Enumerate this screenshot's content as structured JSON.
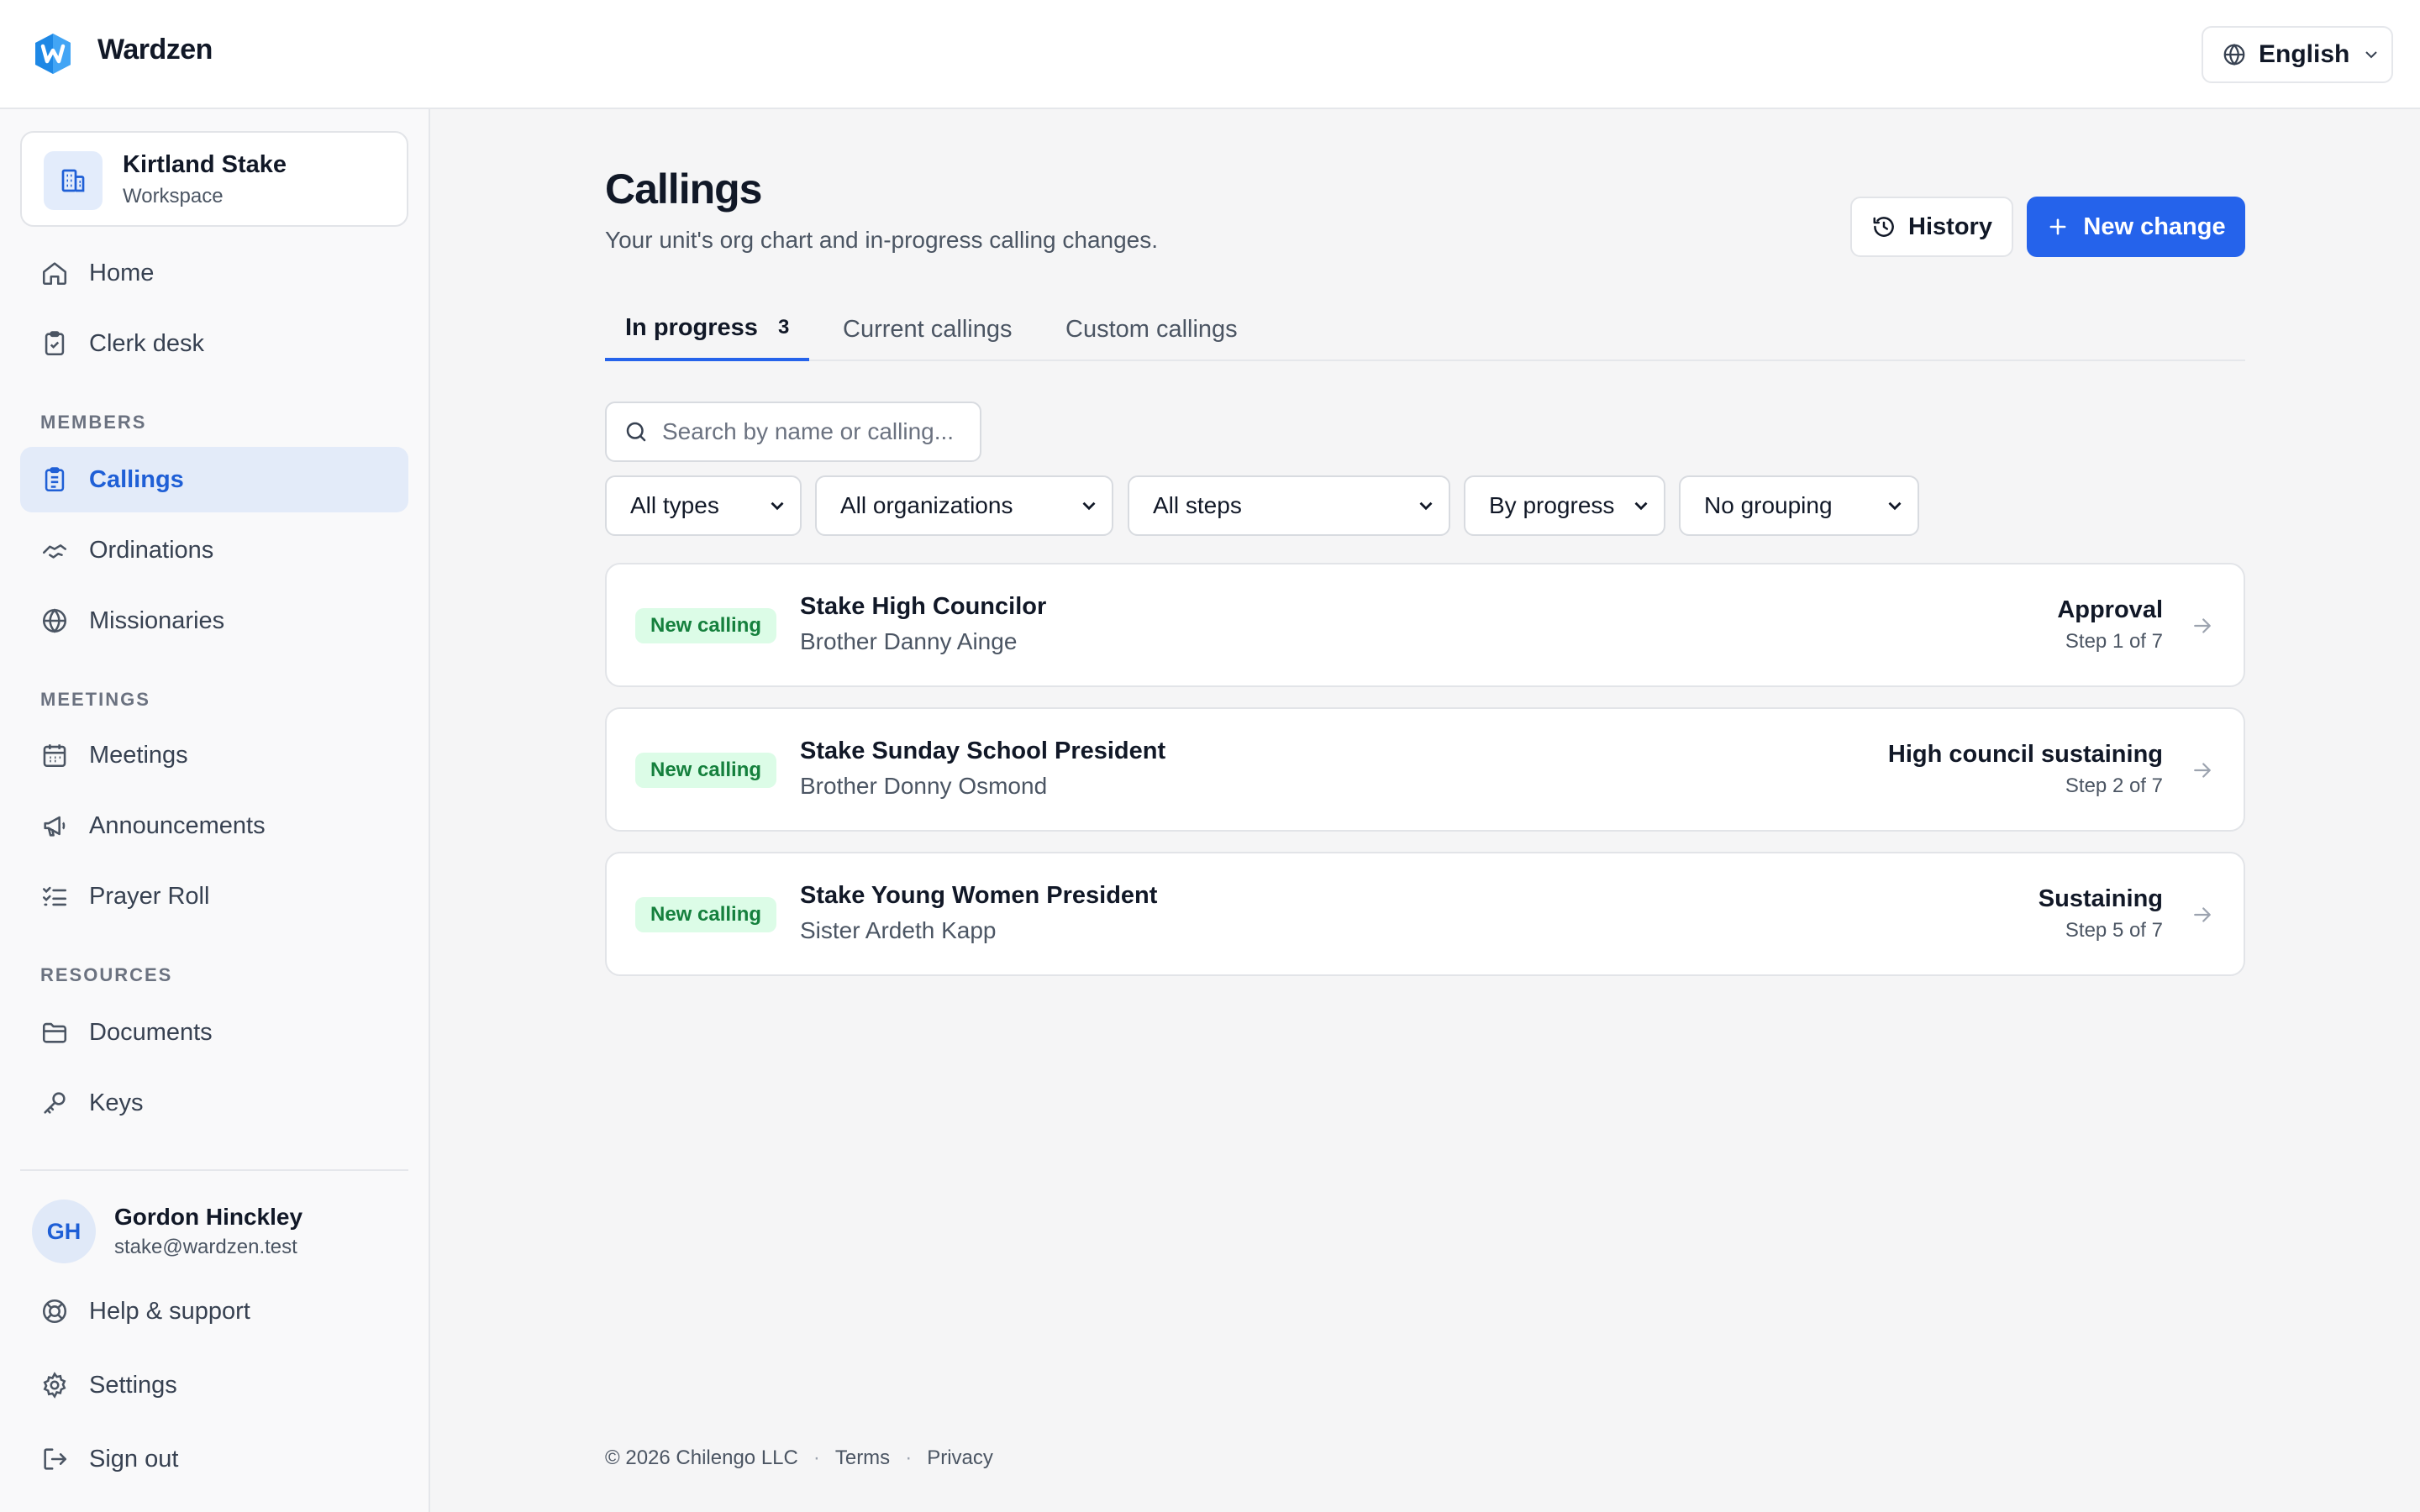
{
  "app": {
    "brand": "Wardzen",
    "language": "English",
    "accent": "#2563eb"
  },
  "workspace": {
    "name": "Kirtland Stake",
    "type": "Workspace"
  },
  "sidebar": {
    "top_items": [
      {
        "label": "Home",
        "icon": "home-icon"
      },
      {
        "label": "Clerk desk",
        "icon": "clipboard-check-icon"
      }
    ],
    "sections": [
      {
        "title": "MEMBERS",
        "items": [
          {
            "label": "Callings",
            "icon": "clipboard-list-icon",
            "active": true
          },
          {
            "label": "Ordinations",
            "icon": "handshake-icon"
          },
          {
            "label": "Missionaries",
            "icon": "globe-icon"
          }
        ]
      },
      {
        "title": "MEETINGS",
        "items": [
          {
            "label": "Meetings",
            "icon": "calendar-icon"
          },
          {
            "label": "Announcements",
            "icon": "megaphone-icon"
          },
          {
            "label": "Prayer Roll",
            "icon": "list-checks-icon"
          }
        ]
      },
      {
        "title": "RESOURCES",
        "items": [
          {
            "label": "Documents",
            "icon": "folder-icon"
          },
          {
            "label": "Keys",
            "icon": "key-icon"
          }
        ]
      }
    ],
    "user": {
      "initials": "GH",
      "name": "Gordon Hinckley",
      "email": "stake@wardzen.test"
    },
    "bottom_items": [
      {
        "label": "Help & support",
        "icon": "lifebuoy-icon"
      },
      {
        "label": "Settings",
        "icon": "gear-icon"
      },
      {
        "label": "Sign out",
        "icon": "sign-out-icon"
      }
    ]
  },
  "page": {
    "title": "Callings",
    "subtitle": "Your unit's org chart and in-progress calling changes.",
    "history_label": "History",
    "new_change_label": "New change"
  },
  "tabs": [
    {
      "label": "In progress",
      "count": "3",
      "active": true
    },
    {
      "label": "Current callings"
    },
    {
      "label": "Custom callings"
    }
  ],
  "search": {
    "placeholder": "Search by name or calling...",
    "value": ""
  },
  "filters": [
    {
      "selected": "All types"
    },
    {
      "selected": "All organizations"
    },
    {
      "selected": "All steps"
    },
    {
      "selected": "By progress"
    },
    {
      "selected": "No grouping"
    }
  ],
  "changes": [
    {
      "badge": "New calling",
      "calling": "Stake High Councilor",
      "person": "Brother Danny Ainge",
      "status": "Approval",
      "step": "Step 1 of 7"
    },
    {
      "badge": "New calling",
      "calling": "Stake Sunday School President",
      "person": "Brother Donny Osmond",
      "status": "High council sustaining",
      "step": "Step 2 of 7"
    },
    {
      "badge": "New calling",
      "calling": "Stake Young Women President",
      "person": "Sister Ardeth Kapp",
      "status": "Sustaining",
      "step": "Step 5 of 7"
    }
  ],
  "footer": {
    "copyright": "© 2026 Chilengo LLC",
    "terms": "Terms",
    "privacy": "Privacy"
  }
}
